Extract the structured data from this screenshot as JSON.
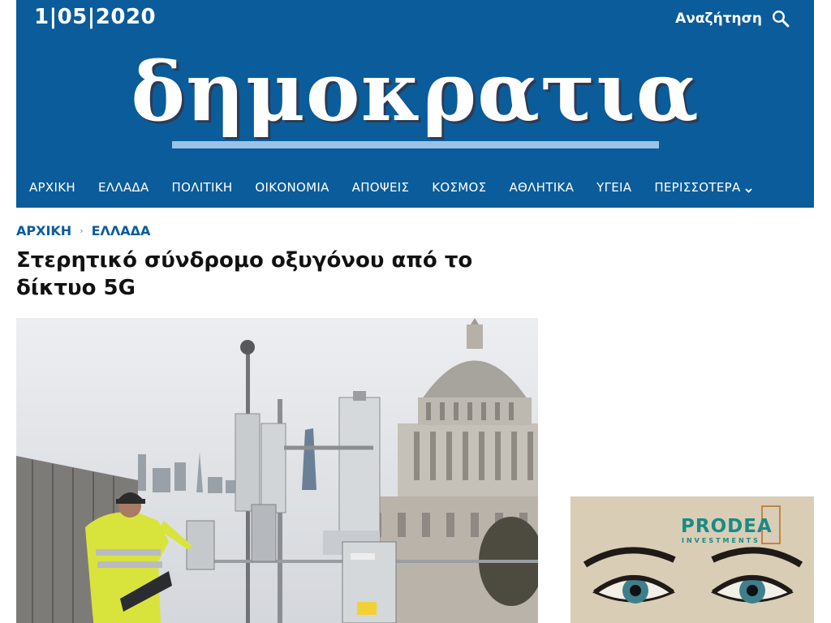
{
  "header": {
    "date": "1|05|2020",
    "search_label": "Αναζήτηση",
    "logo_text": "δημοκρατια",
    "brand_color": "#0b5c9a"
  },
  "nav": {
    "items": [
      {
        "label": "ΑΡΧΙΚΗ"
      },
      {
        "label": "ΕΛΛΑΔΑ"
      },
      {
        "label": "ΠΟΛΙΤΙΚΗ"
      },
      {
        "label": "ΟΙΚΟΝΟΜΙΑ"
      },
      {
        "label": "ΑΠΟΨΕΙΣ"
      },
      {
        "label": "ΚΟΣΜΟΣ"
      },
      {
        "label": "ΑΘΛΗΤΙΚΑ"
      },
      {
        "label": "ΥΓΕΙΑ"
      },
      {
        "label": "ΠΕΡΙΣΣΟΤΕΡΑ"
      }
    ]
  },
  "breadcrumb": {
    "home": "ΑΡΧΙΚΗ",
    "section": "ΕΛΛΑΔΑ"
  },
  "article": {
    "title": "Στερητικό σύνδρομο οξυγόνου από το δίκτυο 5G",
    "title_line1": "Στερητικό σύνδρομο οξυγόνου από το",
    "title_line2": "δίκτυο 5G"
  },
  "ad": {
    "brand": "PRODEA",
    "sub": "INVESTMENTS"
  }
}
